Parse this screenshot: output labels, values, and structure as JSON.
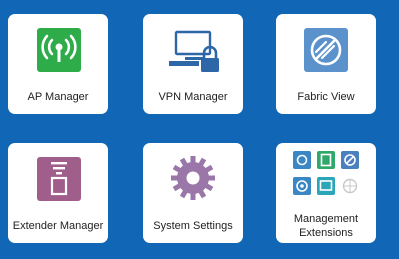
{
  "colors": {
    "background": "#1166b5",
    "tile": "#ffffff",
    "ap_manager_icon": "#2eac4a",
    "vpn_manager_icon": "#2d67a8",
    "fabric_view_icon": "#5b92cc",
    "extender_manager_icon": "#a05e8a",
    "system_settings_icon": "#9a77a8",
    "management_extensions_icon": "#3b87c6"
  },
  "tiles": [
    {
      "id": "ap-manager",
      "label": "AP Manager",
      "icon": "wireless-signal-icon"
    },
    {
      "id": "vpn-manager",
      "label": "VPN Manager",
      "icon": "monitor-lock-icon"
    },
    {
      "id": "fabric-view",
      "label": "Fabric View",
      "icon": "fabric-view-icon"
    },
    {
      "id": "extender-manager",
      "label": "Extender Manager",
      "icon": "extender-icon"
    },
    {
      "id": "system-settings",
      "label": "System Settings",
      "icon": "gear-icon"
    },
    {
      "id": "management-extensions",
      "label_line1": "Management",
      "label_line2": "Extensions",
      "icon": "extension-grid-icon"
    }
  ]
}
